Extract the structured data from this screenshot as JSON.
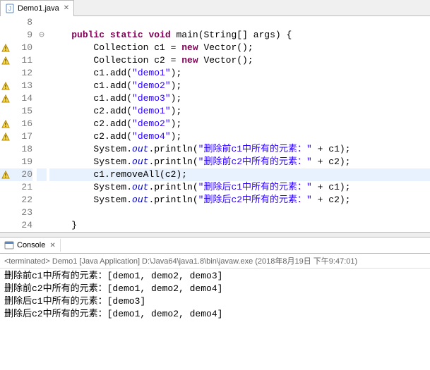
{
  "tab": {
    "label": "Demo1.java"
  },
  "lines": [
    {
      "n": "8",
      "marker": false,
      "fold": "",
      "hl": false,
      "html": ""
    },
    {
      "n": "9",
      "marker": false,
      "fold": "⊖",
      "hl": false,
      "html": "    <span class='kw'>public</span> <span class='kw'>static</span> <span class='kw'>void</span> main(String[] args) {"
    },
    {
      "n": "10",
      "marker": true,
      "fold": "",
      "hl": false,
      "html": "        Collection c1 = <span class='kw'>new</span> Vector();"
    },
    {
      "n": "11",
      "marker": true,
      "fold": "",
      "hl": false,
      "html": "        Collection c2 = <span class='kw'>new</span> Vector();"
    },
    {
      "n": "12",
      "marker": false,
      "fold": "",
      "hl": false,
      "html": "        c1.add(<span class='str'>\"demo1\"</span>);"
    },
    {
      "n": "13",
      "marker": true,
      "fold": "",
      "hl": false,
      "html": "        c1.add(<span class='str'>\"demo2\"</span>);"
    },
    {
      "n": "14",
      "marker": true,
      "fold": "",
      "hl": false,
      "html": "        c1.add(<span class='str'>\"demo3\"</span>);"
    },
    {
      "n": "15",
      "marker": false,
      "fold": "",
      "hl": false,
      "html": "        c2.add(<span class='str'>\"demo1\"</span>);"
    },
    {
      "n": "16",
      "marker": true,
      "fold": "",
      "hl": false,
      "html": "        c2.add(<span class='str'>\"demo2\"</span>);"
    },
    {
      "n": "17",
      "marker": true,
      "fold": "",
      "hl": false,
      "html": "        c2.add(<span class='str'>\"demo4\"</span>);"
    },
    {
      "n": "18",
      "marker": false,
      "fold": "",
      "hl": false,
      "html": "        System.<span class='field'>out</span>.println(<span class='str'>\"删除前c1中所有的元素：\"</span> + c1);"
    },
    {
      "n": "19",
      "marker": false,
      "fold": "",
      "hl": false,
      "html": "        System.<span class='field'>out</span>.println(<span class='str'>\"删除前c2中所有的元素：\"</span> + c2);"
    },
    {
      "n": "20",
      "marker": true,
      "fold": "",
      "hl": true,
      "html": "        c1.removeAll(c2);"
    },
    {
      "n": "21",
      "marker": false,
      "fold": "",
      "hl": false,
      "html": "        System.<span class='field'>out</span>.println(<span class='str'>\"删除后c1中所有的元素：\"</span> + c1);"
    },
    {
      "n": "22",
      "marker": false,
      "fold": "",
      "hl": false,
      "html": "        System.<span class='field'>out</span>.println(<span class='str'>\"删除后c2中所有的元素：\"</span> + c2);"
    },
    {
      "n": "23",
      "marker": false,
      "fold": "",
      "hl": false,
      "html": ""
    },
    {
      "n": "24",
      "marker": false,
      "fold": "",
      "hl": false,
      "html": "    }"
    }
  ],
  "console": {
    "tab_label": "Console",
    "status": "<terminated> Demo1 [Java Application] D:\\Java64\\java1.8\\bin\\javaw.exe (2018年8月19日 下午9:47:01)",
    "output": [
      "删除前c1中所有的元素：[demo1, demo2, demo3]",
      "删除前c2中所有的元素：[demo1, demo2, demo4]",
      "删除后c1中所有的元素：[demo3]",
      "删除后c2中所有的元素：[demo1, demo2, demo4]"
    ]
  }
}
